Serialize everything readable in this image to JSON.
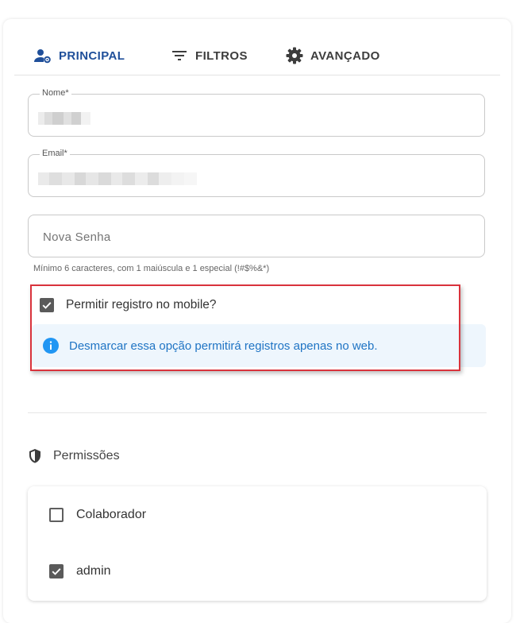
{
  "tabs": [
    {
      "label": "PRINCIPAL",
      "icon": "user-settings-icon",
      "active": true
    },
    {
      "label": "FILTROS",
      "icon": "filter-icon",
      "active": false
    },
    {
      "label": "AVANÇADO",
      "icon": "gear-icon",
      "active": false
    }
  ],
  "form": {
    "nome": {
      "label": "Nome*",
      "value_redacted": true
    },
    "email": {
      "label": "Email*",
      "value_redacted": true
    },
    "senha": {
      "placeholder": "Nova Senha",
      "hint": "Mínimo 6 caracteres, com 1 maiúscula e 1 especial (!#$%&*)"
    }
  },
  "mobile": {
    "label": "Permitir registro no mobile?",
    "checked": true,
    "info": "Desmarcar essa opção permitirá registros apenas no web."
  },
  "permissions": {
    "title": "Permissões",
    "items": [
      {
        "label": "Colaborador",
        "checked": false
      },
      {
        "label": "admin",
        "checked": true
      }
    ]
  },
  "colors": {
    "accent": "#1f4f9a",
    "info_text": "#1f74c4",
    "info_bg": "#eef6fd",
    "highlight": "#d9333c"
  }
}
